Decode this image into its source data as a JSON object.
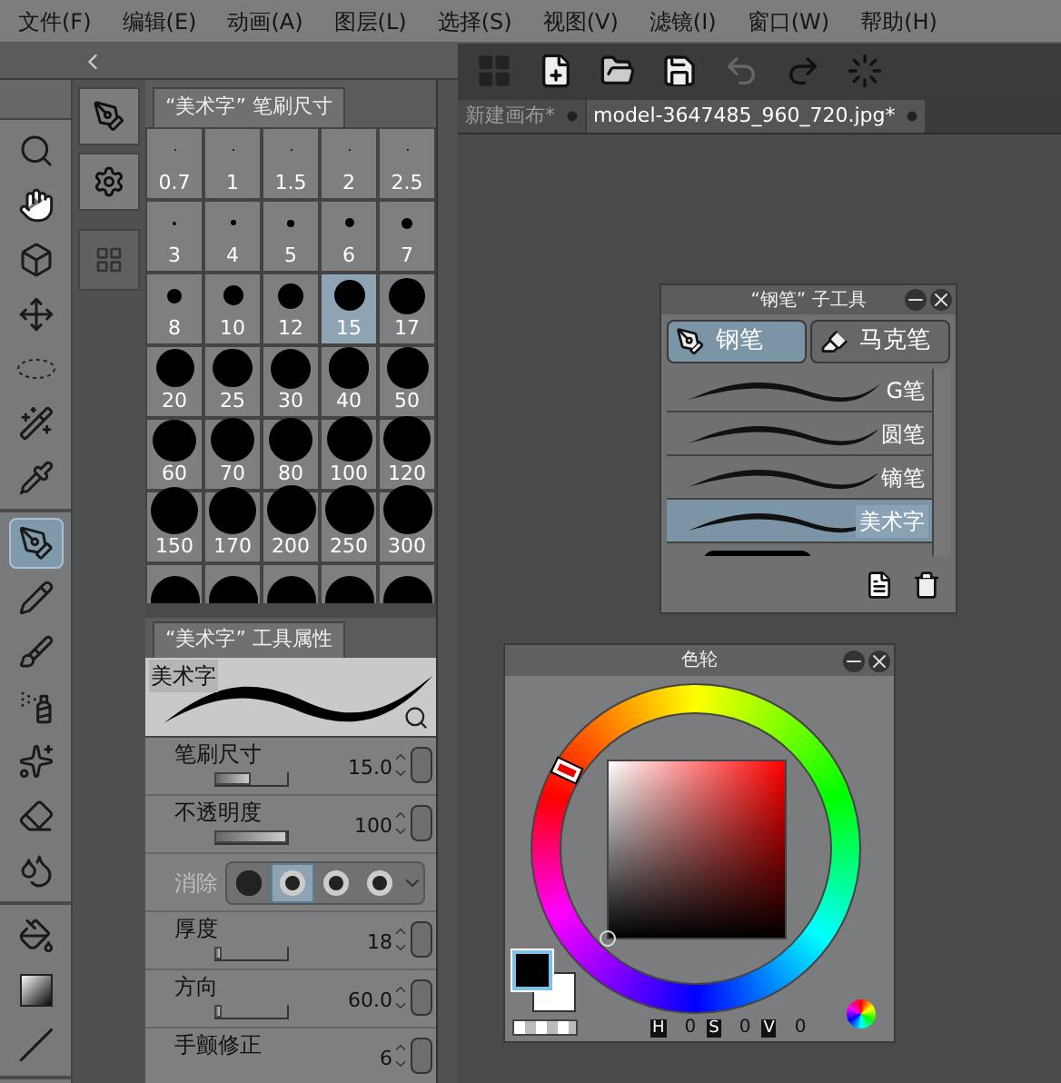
{
  "menu": [
    "文件(F)",
    "编辑(E)",
    "动画(A)",
    "图层(L)",
    "选择(S)",
    "视图(V)",
    "滤镜(I)",
    "窗口(W)",
    "帮助(H)"
  ],
  "tool_groups": [
    [
      {
        "kind": "zoom",
        "selected": false
      },
      {
        "kind": "hand",
        "selected": false
      },
      {
        "kind": "cube",
        "selected": false
      },
      {
        "kind": "move",
        "selected": false
      },
      {
        "kind": "ellipse",
        "selected": false
      },
      {
        "kind": "wand",
        "selected": false
      },
      {
        "kind": "dropper",
        "selected": false
      }
    ],
    [
      {
        "kind": "pen",
        "selected": true
      },
      {
        "kind": "pencil",
        "selected": false
      },
      {
        "kind": "brush",
        "selected": false
      },
      {
        "kind": "spray",
        "selected": false
      },
      {
        "kind": "sparkle",
        "selected": false
      },
      {
        "kind": "eraser",
        "selected": false
      },
      {
        "kind": "drops",
        "selected": false
      }
    ],
    [
      {
        "kind": "bucket",
        "selected": false
      },
      {
        "kind": "gradient",
        "selected": false
      },
      {
        "kind": "line",
        "selected": false
      }
    ]
  ],
  "brush_size": {
    "title": "“美术字” 笔刷尺寸",
    "sizes": [
      {
        "label": "0.7",
        "selected": false
      },
      {
        "label": "1",
        "selected": false
      },
      {
        "label": "1.5",
        "selected": false
      },
      {
        "label": "2",
        "selected": false
      },
      {
        "label": "2.5",
        "selected": false
      },
      {
        "label": "3",
        "selected": false
      },
      {
        "label": "4",
        "selected": false
      },
      {
        "label": "5",
        "selected": false
      },
      {
        "label": "6",
        "selected": false
      },
      {
        "label": "7",
        "selected": false
      },
      {
        "label": "8",
        "selected": false
      },
      {
        "label": "10",
        "selected": false
      },
      {
        "label": "12",
        "selected": false
      },
      {
        "label": "15",
        "selected": true
      },
      {
        "label": "17",
        "selected": false
      },
      {
        "label": "20",
        "selected": false
      },
      {
        "label": "25",
        "selected": false
      },
      {
        "label": "30",
        "selected": false
      },
      {
        "label": "40",
        "selected": false
      },
      {
        "label": "50",
        "selected": false
      },
      {
        "label": "60",
        "selected": false
      },
      {
        "label": "70",
        "selected": false
      },
      {
        "label": "80",
        "selected": false
      },
      {
        "label": "100",
        "selected": false
      },
      {
        "label": "120",
        "selected": false
      },
      {
        "label": "150",
        "selected": false
      },
      {
        "label": "170",
        "selected": false
      },
      {
        "label": "200",
        "selected": false
      },
      {
        "label": "250",
        "selected": false
      },
      {
        "label": "300",
        "selected": false
      }
    ]
  },
  "tool_property": {
    "title": "“美术字” 工具属性",
    "preview_label": "美术字",
    "rows": [
      {
        "kind": "slider",
        "label": "笔刷尺寸",
        "value": "15.0",
        "level": 0.5
      },
      {
        "kind": "slider",
        "label": "不透明度",
        "value": "100",
        "level": 1
      },
      {
        "kind": "options",
        "label": "消除",
        "options": [
          {
            "selected": false
          },
          {
            "selected": true
          },
          {
            "selected": false
          },
          {
            "selected": false
          }
        ]
      },
      {
        "kind": "slider",
        "label": "厚度",
        "value": "18",
        "level": 0.08
      },
      {
        "kind": "slider",
        "label": "方向",
        "value": "60.0",
        "level": 0.08
      },
      {
        "kind": "slider",
        "label": "手颤修正",
        "value": "6"
      }
    ]
  },
  "doc_tabs": [
    {
      "label": "新建画布*",
      "selected": false
    },
    {
      "label": "model-3647485_960_720.jpg*",
      "selected": true
    }
  ],
  "sub_tool": {
    "title": "“钢笔” 子工具",
    "groups": [
      {
        "label": "钢笔",
        "kind": "pen",
        "selected": true
      },
      {
        "label": "马克笔",
        "kind": "marker",
        "selected": false
      }
    ],
    "items": [
      {
        "label": "G笔",
        "selected": false
      },
      {
        "label": "圆笔",
        "selected": false
      },
      {
        "label": "镝笔",
        "selected": false
      },
      {
        "label": "美术字",
        "selected": true
      }
    ]
  },
  "color_wheel": {
    "title": "色轮",
    "readouts": [
      {
        "label": "H",
        "value": "0"
      },
      {
        "label": "S",
        "value": "0"
      },
      {
        "label": "V",
        "value": "0"
      }
    ]
  }
}
